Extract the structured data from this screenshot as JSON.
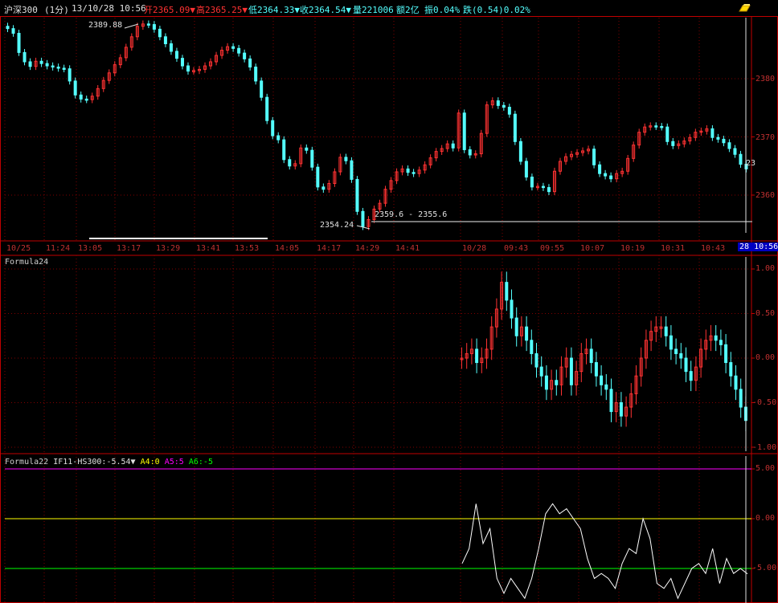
{
  "header": {
    "instrument": "沪深300",
    "period": "(1分)",
    "datetime": "13/10/28 10:56",
    "open": "开2365.09▼",
    "high": "高2365.25▼",
    "low": "低2364.33▼",
    "close": "收2364.54▼",
    "volume": "量221006",
    "amount": "额2亿",
    "amplitude": "振0.04%",
    "change": "跌(0.54)0.02%"
  },
  "main_chart": {
    "price_ticks": [
      "2380",
      "2370",
      "2360"
    ],
    "high_annotation": "2389.88",
    "low_annotation": "2354.24",
    "measure_annotation": "2359.6 - 2355.6",
    "last_price_tag": "23"
  },
  "time_axis": {
    "labels": [
      "10/25",
      "11:24",
      "13:05",
      "13:17",
      "13:29",
      "13:41",
      "13:53",
      "14:05",
      "14:17",
      "14:29",
      "14:41",
      "10/28",
      "09:43",
      "09:55",
      "10:07",
      "10:19",
      "10:31",
      "10:43"
    ],
    "current_date": "28",
    "current_time": "10:56"
  },
  "formula24": {
    "title": "Formula24",
    "ticks": [
      "1.00",
      "0.50",
      "0.00",
      "-0.50",
      "-1.00"
    ]
  },
  "formula22": {
    "title": "Formula22",
    "value_text": "IF11-HS300:-5.54▼",
    "a4": "A4:0",
    "a5": "A5:5",
    "a6": "A6:-5",
    "ticks": [
      "5.00",
      "0.00",
      "-5.00"
    ]
  },
  "colors": {
    "up": "#ff3232",
    "down": "#54ffff",
    "axis": "#c00000",
    "grid": "#800000",
    "a4_line": "#ffff00",
    "a5_line": "#ff00ff",
    "a6_line": "#00ff00"
  },
  "chart_data": [
    {
      "type": "candlestick",
      "title": "沪深300 (1分)",
      "price_ticks": [
        2380,
        2370,
        2360
      ],
      "close_series_estimate": [
        2388.6,
        2387.8,
        2384.5,
        2382.9,
        2382.1,
        2383.0,
        2382.6,
        2382.2,
        2382.0,
        2381.8,
        2381.7,
        2379.6,
        2377.2,
        2376.5,
        2376.4,
        2377.0,
        2378.3,
        2379.7,
        2381.0,
        2382.4,
        2383.6,
        2385.4,
        2387.2,
        2389.0,
        2389.4,
        2389.3,
        2388.5,
        2387.2,
        2386.0,
        2384.7,
        2383.5,
        2382.2,
        2381.3,
        2381.4,
        2381.6,
        2382.2,
        2382.9,
        2384.0,
        2384.9,
        2385.5,
        2385.2,
        2384.4,
        2383.4,
        2382.0,
        2379.6,
        2376.8,
        2372.8,
        2370.2,
        2369.5,
        2366.1,
        2365.0,
        2365.4,
        2368.1,
        2367.7,
        2364.8,
        2361.4,
        2361.0,
        2362.0,
        2364.0,
        2366.5,
        2365.9,
        2362.7,
        2357.2,
        2354.6,
        2355.8,
        2357.6,
        2358.6,
        2361.0,
        2362.5,
        2364.0,
        2364.5,
        2363.9,
        2363.7,
        2364.3,
        2365.2,
        2366.4,
        2367.5,
        2368.0,
        2368.8,
        2368.1,
        2374.1,
        2367.8,
        2366.9,
        2367.1,
        2370.6,
        2375.5,
        2376.2,
        2375.4,
        2375.1,
        2373.9,
        2369.2,
        2365.8,
        2363.1,
        2361.4,
        2361.5,
        2361.3,
        2360.6,
        2364.1,
        2365.8,
        2366.6,
        2367.0,
        2367.3,
        2367.6,
        2367.9,
        2365.2,
        2363.7,
        2363.3,
        2362.8,
        2363.7,
        2364.1,
        2366.3,
        2368.6,
        2370.8,
        2371.7,
        2371.9,
        2371.8,
        2371.7,
        2369.2,
        2368.5,
        2368.8,
        2369.3,
        2369.9,
        2370.8,
        2371.0,
        2371.4,
        2369.9,
        2369.6,
        2369.0,
        2368.0,
        2367.0,
        2365.3,
        2364.5
      ]
    },
    {
      "type": "candlestick",
      "title": "Formula24",
      "y_ticks": [
        1.0,
        0.5,
        0.0,
        -0.5,
        -1.0
      ],
      "ylim": [
        -1,
        1
      ],
      "series_estimate": [
        0.0,
        0.05,
        0.1,
        -0.05,
        0.0,
        0.1,
        0.35,
        0.55,
        0.85,
        0.65,
        0.45,
        0.25,
        0.35,
        0.2,
        0.05,
        -0.1,
        -0.2,
        -0.35,
        -0.25,
        -0.3,
        -0.1,
        0.0,
        -0.3,
        -0.15,
        0.05,
        0.1,
        -0.05,
        -0.2,
        -0.3,
        -0.35,
        -0.6,
        -0.5,
        -0.65,
        -0.55,
        -0.4,
        -0.2,
        0.0,
        0.2,
        0.3,
        0.35,
        0.35,
        0.25,
        0.1,
        0.05,
        0.0,
        -0.15,
        -0.25,
        -0.1,
        0.1,
        0.2,
        0.25,
        0.2,
        0.15,
        -0.05,
        -0.2,
        -0.35,
        -0.55,
        -0.7
      ]
    },
    {
      "type": "line",
      "title": "Formula22",
      "series": [
        {
          "name": "IF11-HS300",
          "values": [
            -4.5,
            -3.0,
            1.5,
            -2.5,
            -1.0,
            -6.0,
            -7.5,
            -6.0,
            -7.0,
            -8.0,
            -6.0,
            -3.0,
            0.5,
            1.5,
            0.5,
            1.0,
            0.0,
            -1.0,
            -4.0,
            -6.0,
            -5.5,
            -6.0,
            -7.0,
            -4.5,
            -3.0,
            -3.5,
            0.0,
            -2.0,
            -6.5,
            -7.0,
            -6.0,
            -8.0,
            -6.5,
            -5.0,
            -4.5,
            -5.5,
            -3.0,
            -6.5,
            -4.0,
            -5.5,
            -5.0,
            -5.54
          ]
        },
        {
          "name": "A4",
          "values": [
            0
          ]
        },
        {
          "name": "A5",
          "values": [
            5
          ]
        },
        {
          "name": "A6",
          "values": [
            -5
          ]
        }
      ],
      "y_ticks": [
        5.0,
        0.0,
        -5.0
      ],
      "ylim": [
        -8,
        5
      ]
    }
  ]
}
